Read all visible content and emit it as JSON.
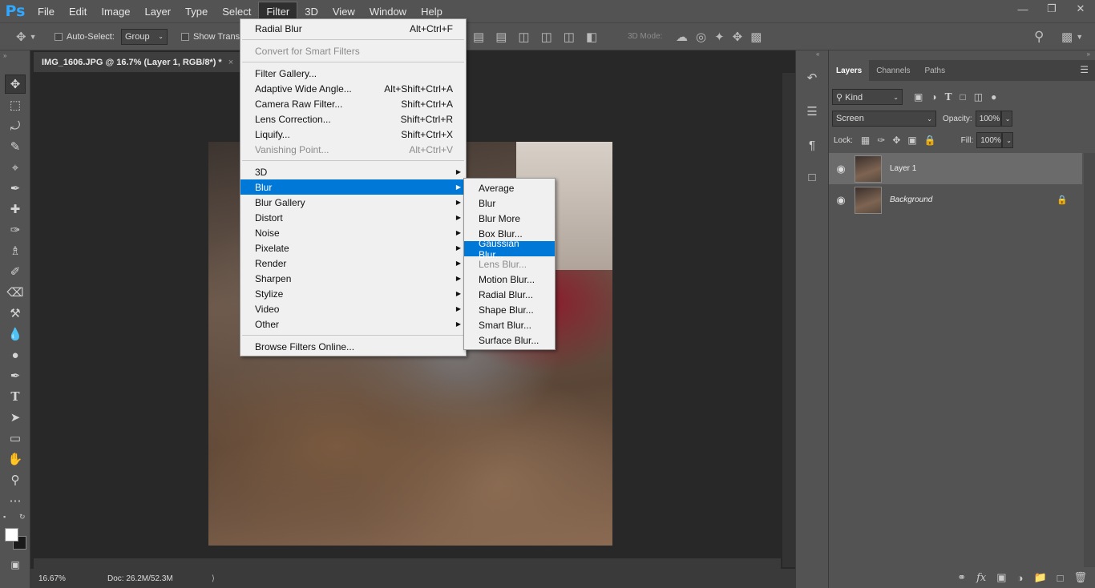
{
  "app": {
    "logo": "Ps"
  },
  "menubar": {
    "items": [
      "File",
      "Edit",
      "Image",
      "Layer",
      "Type",
      "Select",
      "Filter",
      "3D",
      "View",
      "Window",
      "Help"
    ],
    "active": "Filter"
  },
  "options": {
    "auto_select_label": "Auto-Select:",
    "auto_select_value": "Group",
    "show_transform_label": "Show Transf",
    "mode_label": "3D Mode:"
  },
  "document": {
    "tab_title": "IMG_1606.JPG @ 16.7% (Layer 1, RGB/8*) *",
    "zoom": "16.67%",
    "doc_size": "Doc: 26.2M/52.3M"
  },
  "filter_menu": {
    "items": [
      {
        "label": "Radial Blur",
        "shortcut": "Alt+Ctrl+F"
      },
      {
        "sep": true
      },
      {
        "label": "Convert for Smart Filters",
        "disabled": true
      },
      {
        "sep": true
      },
      {
        "label": "Filter Gallery..."
      },
      {
        "label": "Adaptive Wide Angle...",
        "shortcut": "Alt+Shift+Ctrl+A"
      },
      {
        "label": "Camera Raw Filter...",
        "shortcut": "Shift+Ctrl+A"
      },
      {
        "label": "Lens Correction...",
        "shortcut": "Shift+Ctrl+R"
      },
      {
        "label": "Liquify...",
        "shortcut": "Shift+Ctrl+X"
      },
      {
        "label": "Vanishing Point...",
        "shortcut": "Alt+Ctrl+V",
        "disabled": true
      },
      {
        "sep": true
      },
      {
        "label": "3D",
        "submenu": true
      },
      {
        "label": "Blur",
        "submenu": true,
        "highlighted": true
      },
      {
        "label": "Blur Gallery",
        "submenu": true
      },
      {
        "label": "Distort",
        "submenu": true
      },
      {
        "label": "Noise",
        "submenu": true
      },
      {
        "label": "Pixelate",
        "submenu": true
      },
      {
        "label": "Render",
        "submenu": true
      },
      {
        "label": "Sharpen",
        "submenu": true
      },
      {
        "label": "Stylize",
        "submenu": true
      },
      {
        "label": "Video",
        "submenu": true
      },
      {
        "label": "Other",
        "submenu": true
      },
      {
        "sep": true
      },
      {
        "label": "Browse Filters Online..."
      }
    ]
  },
  "blur_submenu": {
    "items": [
      {
        "label": "Average"
      },
      {
        "label": "Blur"
      },
      {
        "label": "Blur More"
      },
      {
        "label": "Box Blur..."
      },
      {
        "label": "Gaussian Blur...",
        "highlighted": true
      },
      {
        "label": "Lens Blur...",
        "disabled": true
      },
      {
        "label": "Motion Blur..."
      },
      {
        "label": "Radial Blur..."
      },
      {
        "label": "Shape Blur..."
      },
      {
        "label": "Smart Blur..."
      },
      {
        "label": "Surface Blur..."
      }
    ]
  },
  "layers_panel": {
    "tabs": [
      "Layers",
      "Channels",
      "Paths"
    ],
    "active_tab": "Layers",
    "kind_label": "Kind",
    "blend_mode": "Screen",
    "opacity_label": "Opacity:",
    "opacity_value": "100%",
    "lock_label": "Lock:",
    "fill_label": "Fill:",
    "fill_value": "100%",
    "layers": [
      {
        "name": "Layer 1",
        "selected": true,
        "locked": false
      },
      {
        "name": "Background",
        "selected": false,
        "locked": true
      }
    ]
  },
  "colors": {
    "menu_highlight": "#0078d7",
    "ps_logo": "#31a8ff"
  }
}
